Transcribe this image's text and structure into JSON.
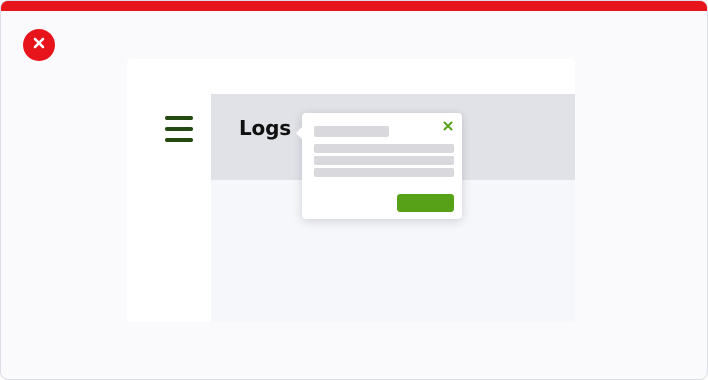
{
  "status": {
    "icon": "close-icon",
    "color": "#e8141b"
  },
  "illustration": {
    "nav_icon": "hamburger-menu-icon",
    "page_title": "Logs",
    "popover": {
      "close_icon": "close-icon",
      "accent_color": "#56a118"
    }
  },
  "colors": {
    "accent": "#e8141b",
    "nav_icon": "#244a12",
    "header_bg": "#e1e2e7",
    "action_button": "#56a118"
  }
}
